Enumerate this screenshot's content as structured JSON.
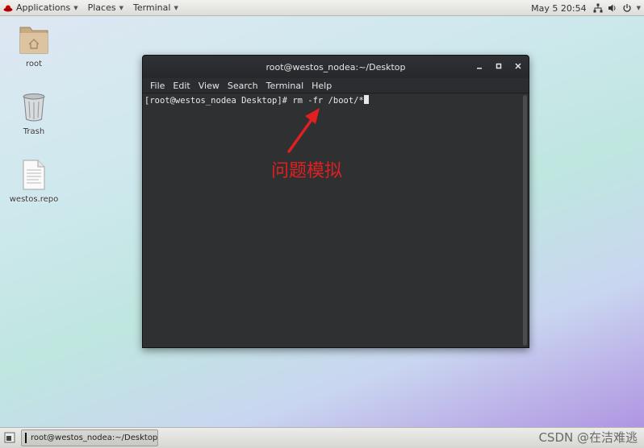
{
  "topbar": {
    "applications_label": "Applications",
    "places_label": "Places",
    "terminal_label": "Terminal",
    "datetime": "May 5  20:54"
  },
  "desktop_icons": [
    {
      "label": "root",
      "icon": "folder-home-icon"
    },
    {
      "label": "Trash",
      "icon": "trash-icon"
    },
    {
      "label": "westos.repo",
      "icon": "text-file-icon"
    }
  ],
  "terminal": {
    "title": "root@westos_nodea:~/Desktop",
    "menu": [
      "File",
      "Edit",
      "View",
      "Search",
      "Terminal",
      "Help"
    ],
    "prompt_line": "[root@westos_nodea Desktop]# rm -fr /boot/*"
  },
  "annotation": {
    "text": "问题模拟",
    "color": "#e02020"
  },
  "taskbar": {
    "window_label": "root@westos_nodea:~/Desktop"
  },
  "watermark": "CSDN @在洁难逃"
}
